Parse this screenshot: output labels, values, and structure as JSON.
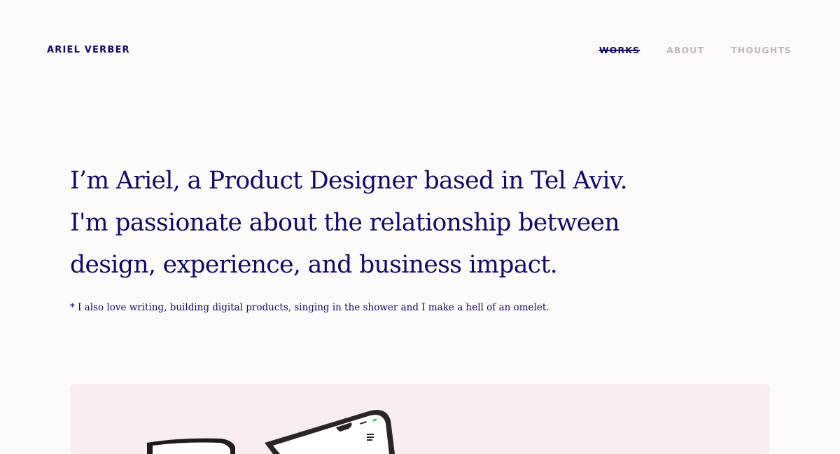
{
  "header": {
    "logo_text": "ARIEL VERBER",
    "nav": [
      {
        "label": "WORKS",
        "active": true
      },
      {
        "label": "ABOUT",
        "active": false
      },
      {
        "label": "THOUGHTS",
        "active": false
      }
    ]
  },
  "hero": {
    "lines": [
      "I’m Ariel, a Product Designer based in Tel Aviv.",
      "I'm passionate about the relationship between",
      "design, experience, and business impact."
    ],
    "footnote": "* I also love writing, building digital products, singing in the shower and I make a hell of an omelet."
  },
  "colors": {
    "background": "#fdfafb",
    "text": "#0f0a62",
    "nav_inactive": "#c6b4c0",
    "showcase_bg": "#f8edf0"
  }
}
